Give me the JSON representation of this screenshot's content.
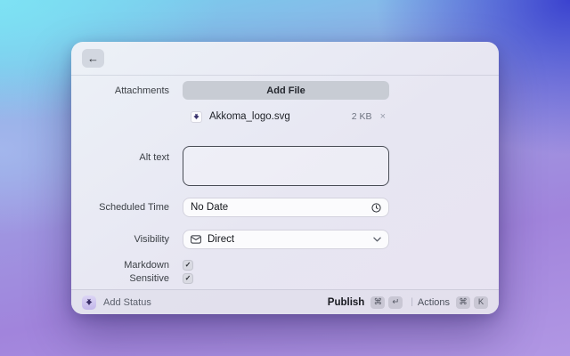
{
  "window": {
    "app": "Raycast-style dialog"
  },
  "icons": {
    "back": "←",
    "close": "×",
    "check": "✓",
    "file_thumbnail": "akkoma-logo",
    "scheduled": "clock",
    "visibility": "envelope",
    "dropdown": "chevron-down"
  },
  "form": {
    "attachments": {
      "label": "Attachments",
      "add_file_label": "Add File",
      "file": {
        "name": "Akkoma_logo.svg",
        "size": "2 KB"
      }
    },
    "alt_text": {
      "label": "Alt text",
      "value": ""
    },
    "scheduled_time": {
      "label": "Scheduled Time",
      "value": "No Date"
    },
    "visibility": {
      "label": "Visibility",
      "value": "Direct"
    },
    "markdown": {
      "label": "Markdown",
      "checked": true
    },
    "sensitive": {
      "label": "Sensitive",
      "checked": true
    }
  },
  "footer": {
    "add_status_label": "Add Status",
    "publish_label": "Publish",
    "publish_keys": [
      "⌘",
      "↵"
    ],
    "separator": "|",
    "actions_label": "Actions",
    "actions_keys": [
      "⌘",
      "K"
    ]
  },
  "colors": {
    "bg_top_left": "#7ee2f4",
    "bg_top_right": "#3b42cf",
    "bg_bottom_purple": "#a98fe0",
    "dialog_bg": "#e9e8f3",
    "logo_purple": "#37316b"
  }
}
